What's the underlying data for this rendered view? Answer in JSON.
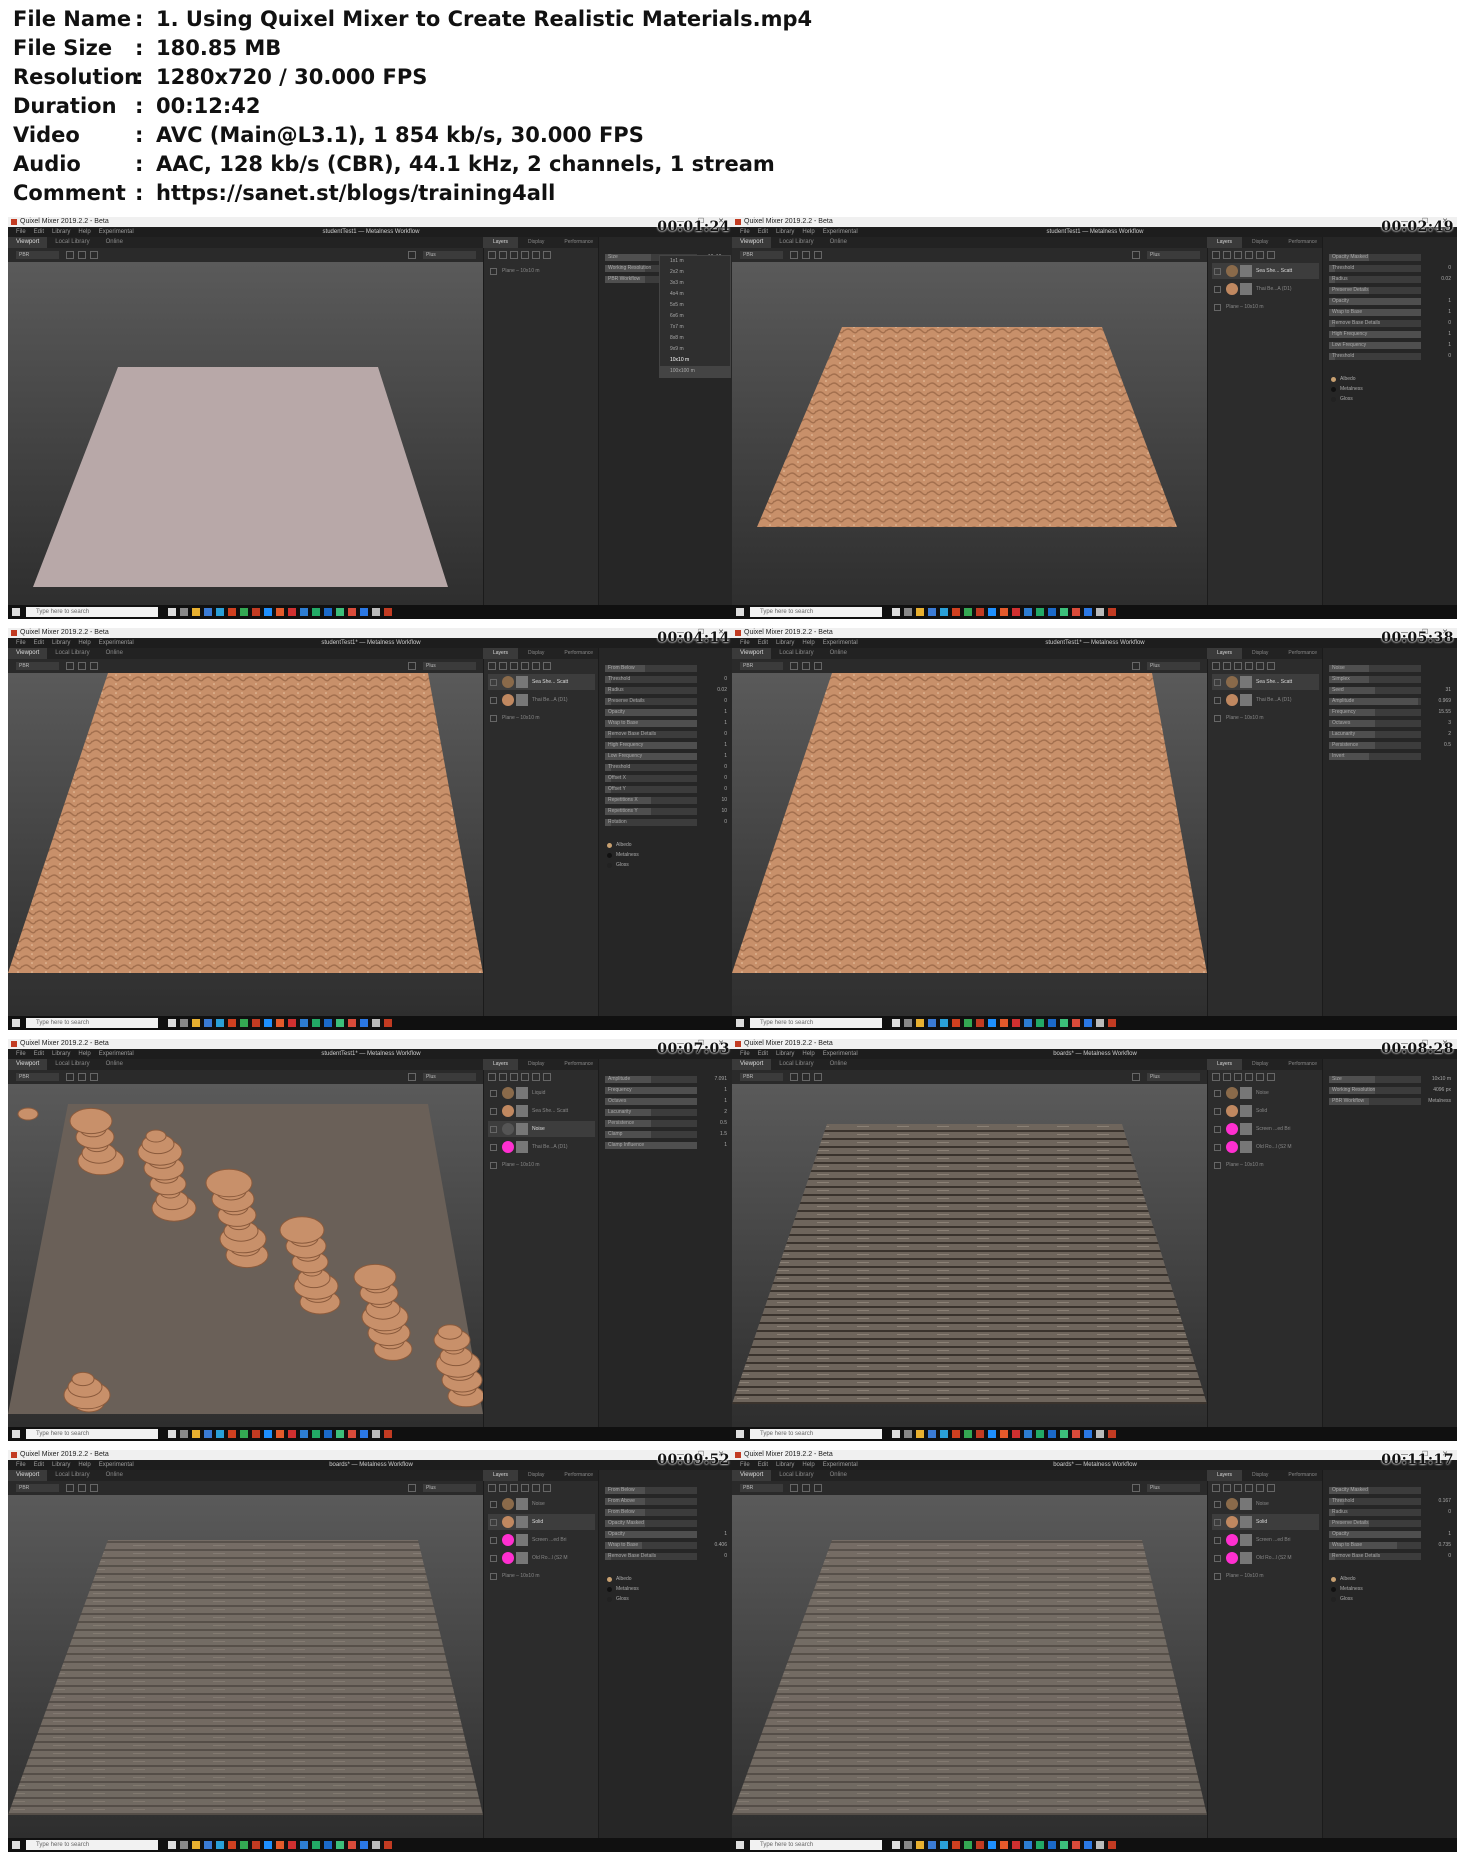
{
  "info": {
    "rows": [
      {
        "key": "File Name",
        "value": "1. Using Quixel Mixer to Create Realistic Materials.mp4"
      },
      {
        "key": "File Size",
        "value": "180.85 MB"
      },
      {
        "key": "Resolution",
        "value": "1280x720 / 30.000 FPS"
      },
      {
        "key": "Duration",
        "value": "00:12:42"
      },
      {
        "key": "Video",
        "value": "AVC (Main@L3.1), 1 854 kb/s, 30.000 FPS"
      },
      {
        "key": "Audio",
        "value": "AAC, 128 kb/s (CBR), 44.1 kHz, 2 channels, 1 stream"
      },
      {
        "key": "Comment",
        "value": "https://sanet.st/blogs/training4all"
      }
    ],
    "separator": ":"
  },
  "app": {
    "window_title": "Quixel Mixer 2019.2.2 - Beta",
    "menu": [
      "File",
      "Edit",
      "Library",
      "Help",
      "Experimental"
    ],
    "viewport_tabs": [
      "Viewport",
      "Local Library",
      "Online"
    ],
    "panel_tabs": [
      "Layers",
      "Display",
      "Performance",
      "Export"
    ],
    "render_mode": "PBR",
    "shading": "Plus",
    "taskbar_search": "Type here to search"
  },
  "thumbs": [
    {
      "timestamp": "00:01:24",
      "doc_title": "studentTest1 — Metalness Workflow",
      "layers": [
        "Plane – 10x10 m"
      ],
      "props": [
        {
          "label": "Size",
          "value": "10x10 m"
        },
        {
          "label": "Working Resolution",
          "value": ""
        },
        {
          "label": "PBR Workflow",
          "value": ""
        }
      ],
      "dropdown": [
        "1x1 m",
        "2x2 m",
        "3x3 m",
        "4x4 m",
        "5x5 m",
        "6x6 m",
        "7x7 m",
        "8x8 m",
        "9x9 m",
        "10x10 m",
        "100x100 m"
      ]
    },
    {
      "timestamp": "00:02:49",
      "doc_title": "studentTest1 — Metalness Workflow",
      "layers": [
        "Sea She... Scatt",
        "Thai Be...A (D1)",
        "Plane – 10x10 m"
      ],
      "props": [
        {
          "label": "Opacity Masked",
          "value": ""
        },
        {
          "label": "Threshold",
          "value": "0"
        },
        {
          "label": "Radius",
          "value": "0.02"
        },
        {
          "label": "Preserve Details",
          "value": ""
        },
        {
          "label": "Opacity",
          "value": "1"
        },
        {
          "label": "Wrap to Base",
          "value": "1"
        },
        {
          "label": "Remove Base Details",
          "value": "0"
        },
        {
          "label": "High Frequency",
          "value": "1"
        },
        {
          "label": "Low Frequency",
          "value": "1"
        },
        {
          "label": "Threshold",
          "value": "0"
        }
      ]
    },
    {
      "timestamp": "00:04:14",
      "doc_title": "studentTest1* — Metalness Workflow",
      "layers": [
        "Sea She... Scatt",
        "Thai Be...A (D1)",
        "Plane – 10x10 m"
      ],
      "props": [
        {
          "label": "From Below",
          "value": ""
        },
        {
          "label": "Threshold",
          "value": "0"
        },
        {
          "label": "Radius",
          "value": "0.02"
        },
        {
          "label": "Preserve Details",
          "value": "0"
        },
        {
          "label": "Opacity",
          "value": "1"
        },
        {
          "label": "Wrap to Base",
          "value": "1"
        },
        {
          "label": "Remove Base Details",
          "value": "0"
        },
        {
          "label": "High Frequency",
          "value": "1"
        },
        {
          "label": "Low Frequency",
          "value": "1"
        },
        {
          "label": "Threshold",
          "value": "0"
        },
        {
          "label": "Offset X",
          "value": "0"
        },
        {
          "label": "Offset Y",
          "value": "0"
        },
        {
          "label": "Repetitions X",
          "value": "10"
        },
        {
          "label": "Repetitions Y",
          "value": "10"
        },
        {
          "label": "Rotation",
          "value": "0"
        }
      ]
    },
    {
      "timestamp": "00:05:38",
      "doc_title": "studentTest1* — Metalness Workflow",
      "layers": [
        "Sea She... Scatt",
        "Thai Be...A (D1)",
        "Plane – 10x10 m"
      ],
      "props": [
        {
          "label": "Noise",
          "value": ""
        },
        {
          "label": "Simplex",
          "value": ""
        },
        {
          "label": "Seed",
          "value": "31"
        },
        {
          "label": "Amplitude",
          "value": "0.969"
        },
        {
          "label": "Frequency",
          "value": "15.55"
        },
        {
          "label": "Octaves",
          "value": "3"
        },
        {
          "label": "Lacunarity",
          "value": "2"
        },
        {
          "label": "Persistence",
          "value": "0.5"
        },
        {
          "label": "Invert",
          "value": ""
        }
      ]
    },
    {
      "timestamp": "00:07:03",
      "doc_title": "studentTest1* — Metalness Workflow",
      "layers": [
        "Liquid",
        "Sea She... Scatt",
        "Noise",
        "Thai Be...A (D1)",
        "Plane – 10x10 m"
      ],
      "props": [
        {
          "label": "Amplitude",
          "value": "7.091"
        },
        {
          "label": "Frequency",
          "value": "1"
        },
        {
          "label": "Octaves",
          "value": "1"
        },
        {
          "label": "Lacunarity",
          "value": "2"
        },
        {
          "label": "Persistence",
          "value": "0.5"
        },
        {
          "label": "Clamp",
          "value": "1.5"
        },
        {
          "label": "Clamp Influence",
          "value": "1"
        }
      ]
    },
    {
      "timestamp": "00:08:28",
      "doc_title": "boards* — Metalness Workflow",
      "layers": [
        "Noise",
        "Solid",
        "Screen ...ed Bri",
        "Old Ro...l (S2 M",
        "Plane – 10x10 m"
      ],
      "props": [
        {
          "label": "Size",
          "value": "10x10 m"
        },
        {
          "label": "Working Resolution",
          "value": "4096 px"
        },
        {
          "label": "PBR Workflow",
          "value": "Metalness"
        }
      ]
    },
    {
      "timestamp": "00:09:52",
      "doc_title": "boards* — Metalness Workflow",
      "layers": [
        "Noise",
        "Solid",
        "Screen ...ed Bri",
        "Old Ro...l (S2 M",
        "Plane – 10x10 m"
      ],
      "props": [
        {
          "label": "From Below",
          "value": ""
        },
        {
          "label": "From Above",
          "value": ""
        },
        {
          "label": "From Below",
          "value": ""
        },
        {
          "label": "Opacity Masked",
          "value": ""
        },
        {
          "label": "Opacity",
          "value": "1"
        },
        {
          "label": "Wrap to Base",
          "value": "0.406"
        },
        {
          "label": "Remove Base Details",
          "value": "0"
        }
      ]
    },
    {
      "timestamp": "00:11:17",
      "doc_title": "boards* — Metalness Workflow",
      "layers": [
        "Noise",
        "Solid",
        "Screen ...ed Bri",
        "Old Ro...l (S2 M",
        "Plane – 10x10 m"
      ],
      "props": [
        {
          "label": "Opacity Masked",
          "value": ""
        },
        {
          "label": "Threshold",
          "value": "0.167"
        },
        {
          "label": "Radius",
          "value": "0"
        },
        {
          "label": "Preserve Details",
          "value": ""
        },
        {
          "label": "Opacity",
          "value": "1"
        },
        {
          "label": "Wrap to Base",
          "value": "0.735"
        },
        {
          "label": "Remove Base Details",
          "value": "0"
        }
      ]
    }
  ],
  "reflectance": [
    "Albedo",
    "Metalness",
    "Gloss"
  ],
  "colors": {
    "sand": "#c8906a",
    "sand_dark": "#8a5a3c",
    "boards": "#6e655c",
    "plane_flat": "#b8a8a8",
    "liquid": "#6a6058",
    "bg_viewport": "#4a4a4a"
  }
}
